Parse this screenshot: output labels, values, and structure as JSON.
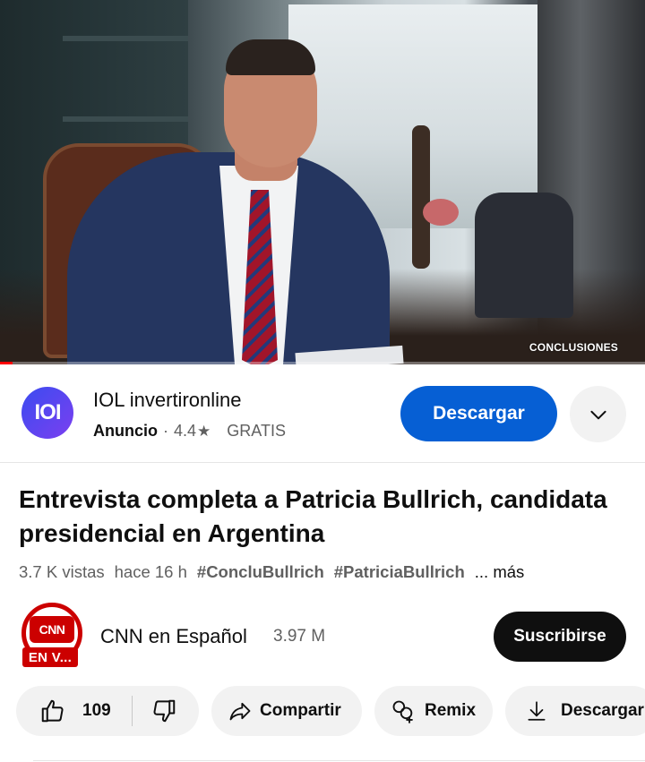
{
  "video": {
    "overlay_label": "CONCLUSIONES",
    "progress_fraction": 0.02
  },
  "ad": {
    "logo_text": "IOI",
    "title": "IOL invertironline",
    "sponsored_label": "Anuncio",
    "separator": "·",
    "rating": "4.4",
    "star": "★",
    "price": "GRATIS",
    "cta_label": "Descargar",
    "brand_color": "#065fd4"
  },
  "title": "Entrevista completa a Patricia Bullrich, candidata presidencial en Argentina",
  "meta": {
    "views": "3.7 K vistas",
    "age": "hace 16 h",
    "tags": [
      "#ConcluBullrich",
      "#PatriciaBullrich"
    ],
    "more": "... más"
  },
  "channel": {
    "logo_text": "CNN",
    "live_badge": "EN V...",
    "name": "CNN en Español",
    "subscribers": "3.97 M",
    "subscribe_label": "Suscribirse",
    "accent_color": "#cc0000"
  },
  "actions": {
    "like_count": "109",
    "share_label": "Compartir",
    "remix_label": "Remix",
    "download_label": "Descargar"
  },
  "icons": [
    "thumbs-up-icon",
    "thumbs-down-icon",
    "share-icon",
    "remix-icon",
    "download-icon",
    "chevron-down-icon"
  ]
}
